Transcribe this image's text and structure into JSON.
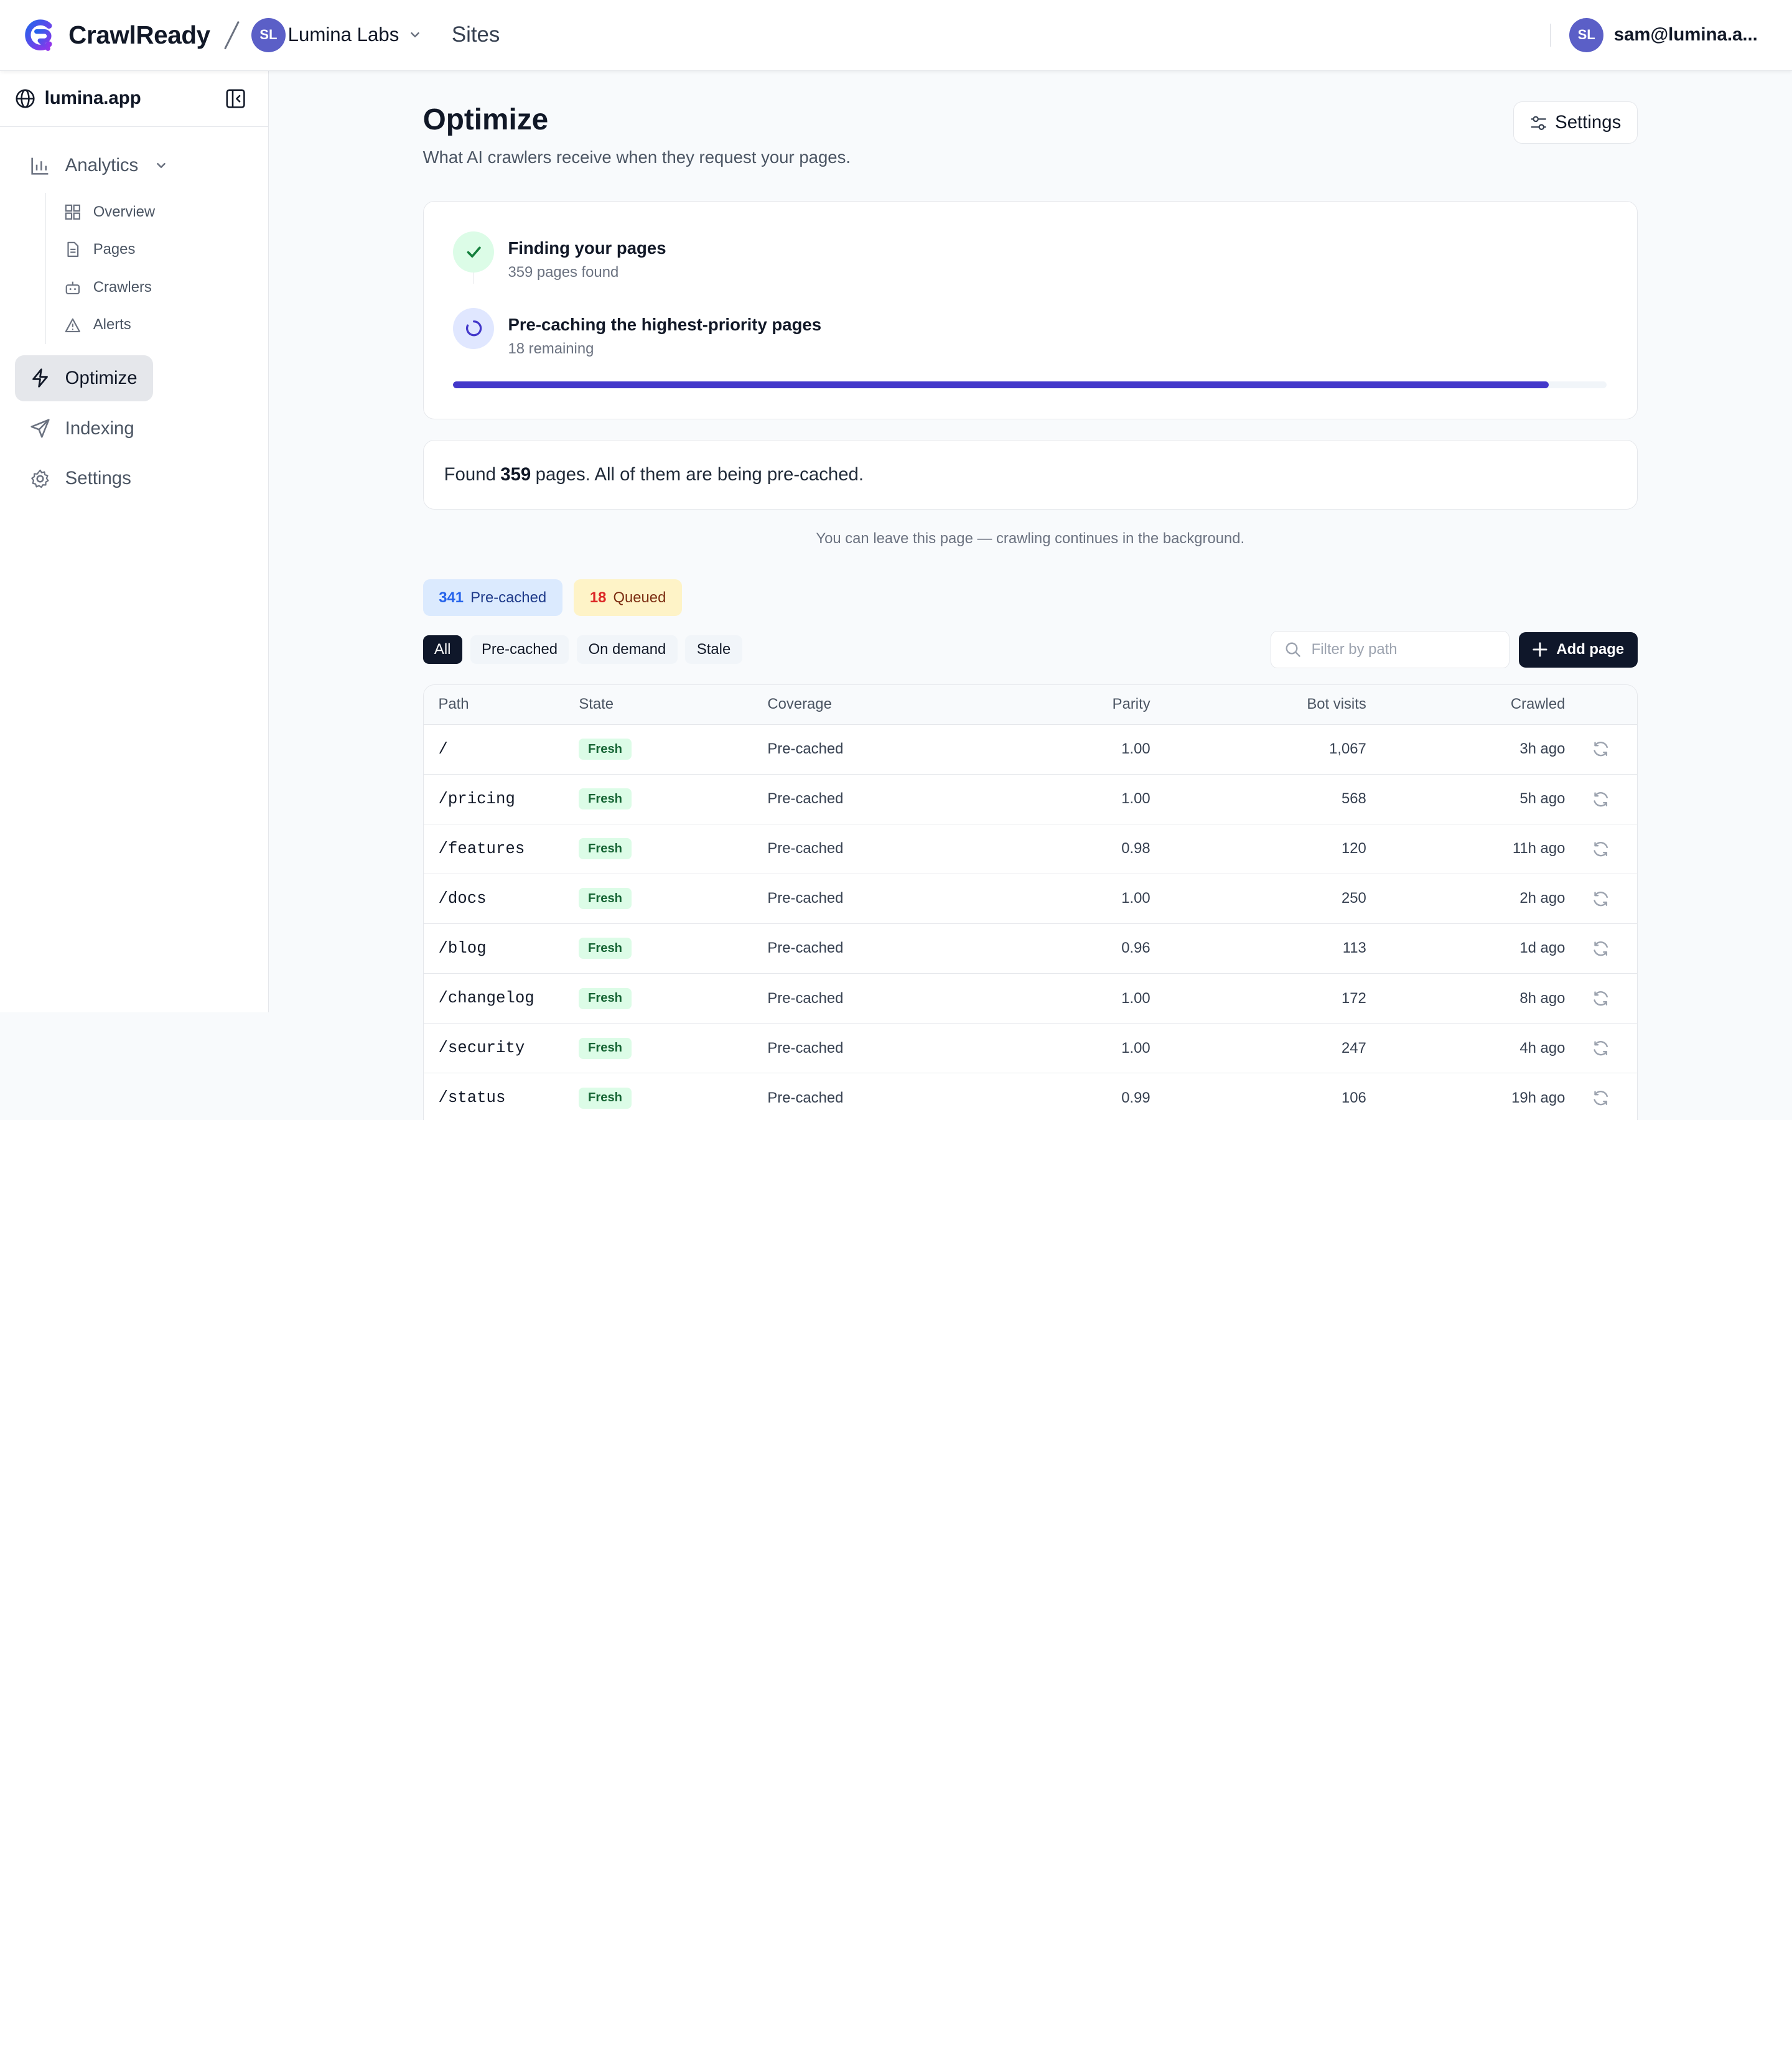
{
  "app": {
    "brand": "CrawlReady",
    "org_initials": "SL",
    "org_name": "Lumina Labs",
    "breadcrumb_current": "Sites"
  },
  "user": {
    "initials": "SL",
    "email": "sam@lumina.a..."
  },
  "sidebar": {
    "site": "lumina.app",
    "analytics_label": "Analytics",
    "analytics_items": [
      {
        "label": "Overview",
        "icon": "grid-icon"
      },
      {
        "label": "Pages",
        "icon": "file-icon"
      },
      {
        "label": "Crawlers",
        "icon": "bot-icon"
      },
      {
        "label": "Alerts",
        "icon": "alert-triangle-icon"
      }
    ],
    "optimize_label": "Optimize",
    "indexing_label": "Indexing",
    "settings_label": "Settings"
  },
  "page": {
    "title": "Optimize",
    "subtitle": "What AI crawlers receive when they request your pages.",
    "settings_button": "Settings"
  },
  "progress": {
    "step1_title": "Finding your pages",
    "step1_meta": "359 pages found",
    "step2_title": "Pre-caching the highest-priority pages",
    "step2_meta": "18 remaining",
    "percent": 95
  },
  "summary": {
    "prefix": "Found",
    "count": "359",
    "suffix": "pages. All of them are being pre-cached.",
    "note": "You can leave this page — crawling continues in the background."
  },
  "chips": {
    "precached_count": "341",
    "precached_label": "Pre-cached",
    "queued_count": "18",
    "queued_label": "Queued"
  },
  "filters": {
    "tabs": [
      "All",
      "Pre-cached",
      "On demand",
      "Stale"
    ],
    "active": "All",
    "search_placeholder": "Filter by path",
    "add_button": "Add page"
  },
  "table": {
    "headers": {
      "path": "Path",
      "state": "State",
      "coverage": "Coverage",
      "parity": "Parity",
      "bot_visits": "Bot visits",
      "crawled": "Crawled"
    },
    "rows": [
      {
        "path": "/",
        "state": "Fresh",
        "coverage": "Pre-cached",
        "parity": "1.00",
        "bot_visits": "1,067",
        "crawled": "3h ago"
      },
      {
        "path": "/pricing",
        "state": "Fresh",
        "coverage": "Pre-cached",
        "parity": "1.00",
        "bot_visits": "568",
        "crawled": "5h ago"
      },
      {
        "path": "/features",
        "state": "Fresh",
        "coverage": "Pre-cached",
        "parity": "0.98",
        "bot_visits": "120",
        "crawled": "11h ago"
      },
      {
        "path": "/docs",
        "state": "Fresh",
        "coverage": "Pre-cached",
        "parity": "1.00",
        "bot_visits": "250",
        "crawled": "2h ago"
      },
      {
        "path": "/blog",
        "state": "Fresh",
        "coverage": "Pre-cached",
        "parity": "0.96",
        "bot_visits": "113",
        "crawled": "1d ago"
      },
      {
        "path": "/changelog",
        "state": "Fresh",
        "coverage": "Pre-cached",
        "parity": "1.00",
        "bot_visits": "172",
        "crawled": "8h ago"
      },
      {
        "path": "/security",
        "state": "Fresh",
        "coverage": "Pre-cached",
        "parity": "1.00",
        "bot_visits": "247",
        "crawled": "4h ago"
      },
      {
        "path": "/status",
        "state": "Fresh",
        "coverage": "Pre-cached",
        "parity": "0.99",
        "bot_visits": "106",
        "crawled": "19h ago"
      }
    ]
  },
  "colors": {
    "accent": "#4338ca",
    "primary_dark": "#0f172a",
    "fresh_bg": "#dcfce7",
    "fresh_text": "#166534"
  }
}
